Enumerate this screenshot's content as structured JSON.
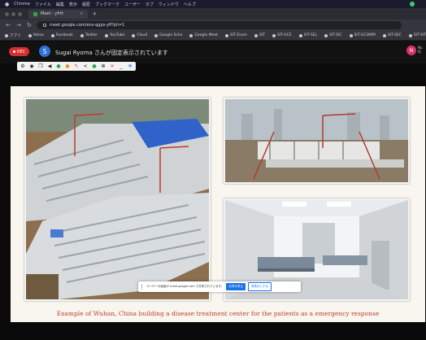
{
  "menubar": {
    "app": "Chrome",
    "items": [
      "ファイル",
      "編集",
      "表示",
      "履歴",
      "ブックマーク",
      "ユーザー",
      "タブ",
      "ウィンドウ",
      "ヘルプ"
    ]
  },
  "tab": {
    "title": "Meet - yfrtt",
    "close": "×",
    "new": "+"
  },
  "address": {
    "url": "meet.google.com/ens-qgps-yff?pli=1"
  },
  "bookmarks": [
    "アプリ",
    "Yahoo",
    "Facebook",
    "Twitter",
    "YouTube",
    "Cloud",
    "Google Scho",
    "Google Meet",
    "SIT-Zoom",
    "SIT",
    "SIT-GCE",
    "SIT-SEL",
    "SIT-SIC",
    "SIT-GCOMM",
    "SIT-SEC",
    "SIT-SIT"
  ],
  "meet": {
    "rec_label": "REC",
    "presenter_initial": "S",
    "presenting_text": "Sugai Ryoma さんが固定表示されています",
    "user_initial": "N",
    "user_label_1": "Nu",
    "user_label_2": "lfj"
  },
  "slide": {
    "caption": "Example of Wuhan, China building a disease treatment center for the patients as a emergency response"
  },
  "notice": {
    "text": "ユーザーの画面が meet.google.com で共有されています。",
    "stop_label": "共有を停止",
    "hide_label": "非表示にする"
  },
  "colors": {
    "rec": "#d62f2f",
    "presenter_avatar": "#2f6fd6",
    "user_avatar": "#d6336c",
    "caption": "#c0392b",
    "stop_button": "#1a73e8"
  }
}
